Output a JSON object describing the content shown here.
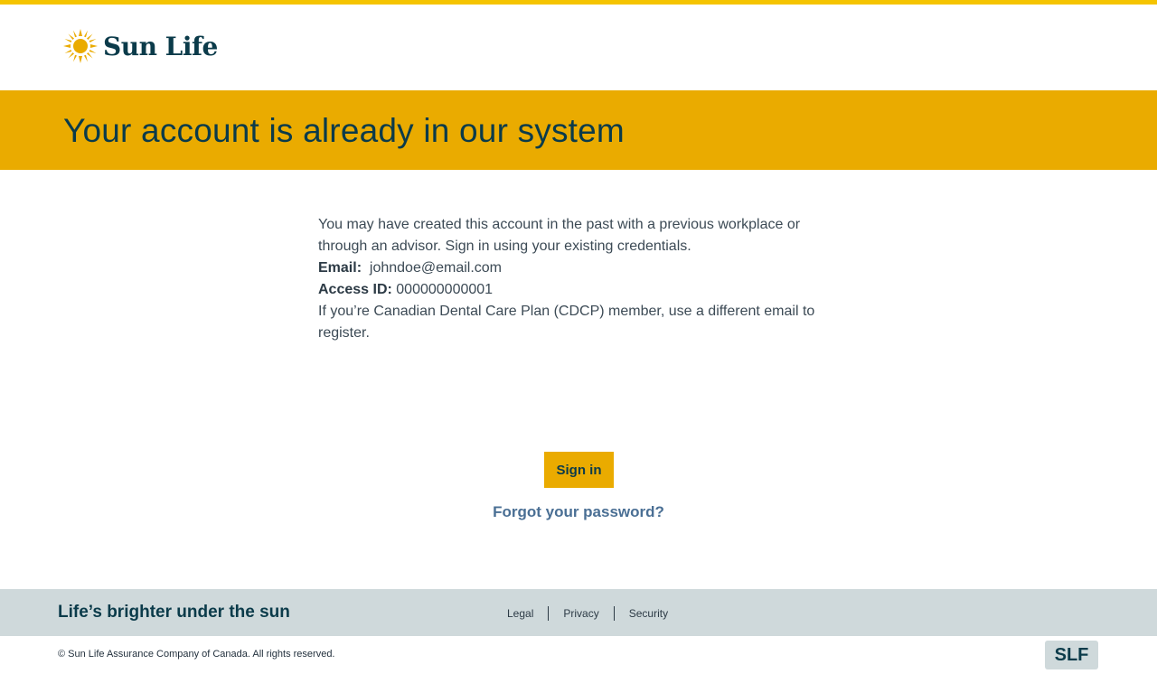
{
  "header": {
    "brand": "Sun Life"
  },
  "banner": {
    "title": "Your account is already in our system"
  },
  "main": {
    "intro": "You may have created this account in the past with a previous workplace or through an advisor. Sign in using your existing credentials.",
    "email_label": "Email:",
    "email_value": "johndoe@email.com",
    "access_label": "Access ID:",
    "access_value": "000000000001",
    "cdcp_note": "If you’re Canadian Dental Care Plan (CDCP) member, use a different email to register.",
    "signin_label": "Sign in",
    "forgot_label": "Forgot your password?"
  },
  "footer": {
    "tagline": "Life’s brighter under the sun",
    "links": [
      "Legal",
      "Privacy",
      "Security"
    ],
    "copyright": "© Sun Life Assurance Company of Canada. All rights reserved.",
    "ticker": "SLF"
  },
  "colors": {
    "accent_yellow": "#eaab00",
    "top_stripe": "#f5c400",
    "brand_navy": "#0b3b4a",
    "link_blue": "#4a6f94",
    "footer_gray": "#cfd9db"
  },
  "icons": {
    "logo": "sun-logo-icon"
  }
}
